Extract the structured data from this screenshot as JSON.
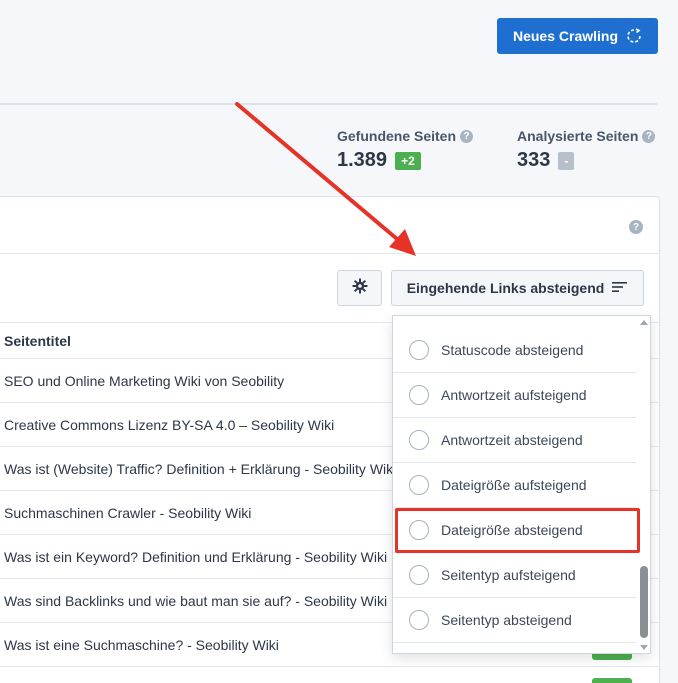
{
  "header": {
    "new_crawl_label": "Neues Crawling"
  },
  "stats": {
    "found": {
      "label": "Gefundene Seiten",
      "value": "1.389",
      "badge": "+2"
    },
    "analyzed": {
      "label": "Analysierte Seiten",
      "value": "333",
      "badge": "-"
    }
  },
  "toolbar": {
    "sort_label": "Eingehende Links absteigend"
  },
  "table": {
    "column_header": "Seitentitel",
    "rows": [
      "SEO und Online Marketing Wiki von Seobility",
      "Creative Commons Lizenz BY-SA 4.0 – Seobility Wiki",
      "Was ist (Website) Traffic? Definition + Erklärung - Seobility Wiki",
      "Suchmaschinen Crawler - Seobility Wiki",
      "Was ist ein Keyword? Definition und Erklärung - Seobility Wiki",
      "Was sind Backlinks und wie baut man sie auf? - Seobility Wiki",
      "Was ist eine Suchmaschine? - Seobility Wiki"
    ]
  },
  "sort_dropdown": {
    "options": [
      "Statuscode absteigend",
      "Antwortzeit aufsteigend",
      "Antwortzeit absteigend",
      "Dateigröße aufsteigend",
      "Dateigröße absteigend",
      "Seitentyp aufsteigend",
      "Seitentyp absteigend"
    ],
    "highlighted": "Dateigröße absteigend"
  },
  "colors": {
    "primary": "#1f6fd1",
    "success": "#4caf50",
    "annotation": "#e53327"
  },
  "icons": [
    "refresh-icon",
    "help-icon",
    "gear-icon",
    "sort-lines-icon"
  ]
}
